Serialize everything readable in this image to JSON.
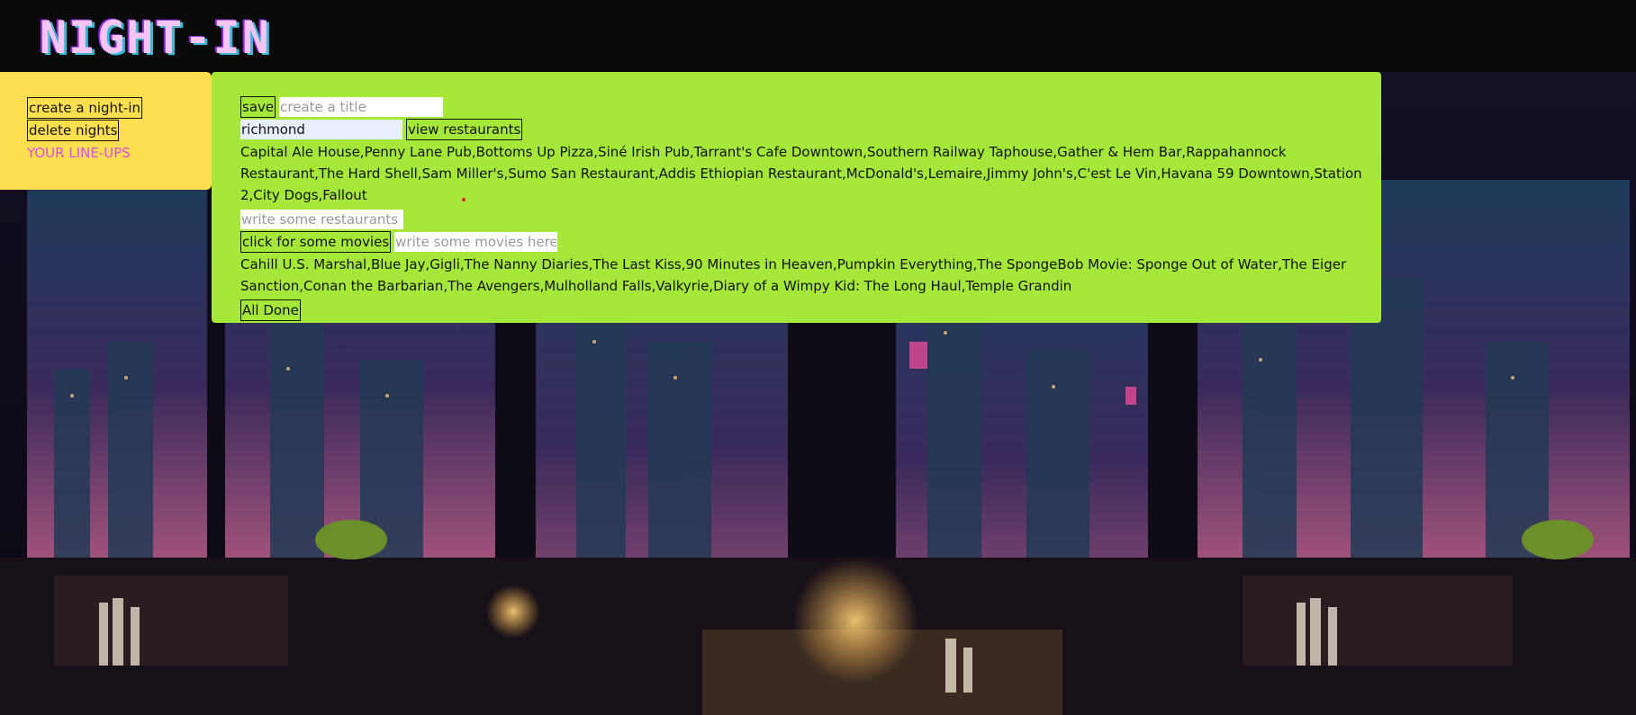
{
  "header": {
    "logo_text": "NIGHT-IN"
  },
  "sidebar": {
    "create_label": "create a night-in",
    "delete_label": "delete nights",
    "lineups_label": "YOUR LINE-UPS"
  },
  "main": {
    "save_label": "save",
    "title_placeholder": "create a title",
    "city_value": "richmond",
    "view_restaurants_label": "view restaurants",
    "restaurants_text": "Capital Ale House,Penny Lane Pub,Bottoms Up Pizza,Siné Irish Pub,Tarrant's Cafe Downtown,Southern Railway Taphouse,Gather & Hem Bar,Rappahannock Restaurant,The Hard Shell,Sam Miller's,Sumo San Restaurant,Addis Ethiopian Restaurant,McDonald's,Lemaire,Jimmy John's,C'est Le Vin,Havana 59 Downtown,Station 2,City Dogs,Fallout",
    "restaurant_placeholder": "write some restaurants here",
    "movies_button_label": "click for some movies",
    "movie_placeholder": "write some movies here",
    "movies_text": "Cahill U.S. Marshal,Blue Jay,Gigli,The Nanny Diaries,The Last Kiss,90 Minutes in Heaven,Pumpkin Everything,The SpongeBob Movie: Sponge Out of Water,The Eiger Sanction,Conan the Barbarian,The Avengers,Mulholland Falls,Valkyrie,Diary of a Wimpy Kid: The Long Haul,Temple Grandin",
    "all_done_label": "All Done"
  },
  "colors": {
    "header_bg": "#0a0a0a",
    "sidebar_bg": "#fddf4f",
    "panel_bg": "#a6e83a",
    "logo_pink": "#f7c4f4",
    "logo_cyan": "#35b9d6",
    "lineups_link": "#d94ee8"
  }
}
